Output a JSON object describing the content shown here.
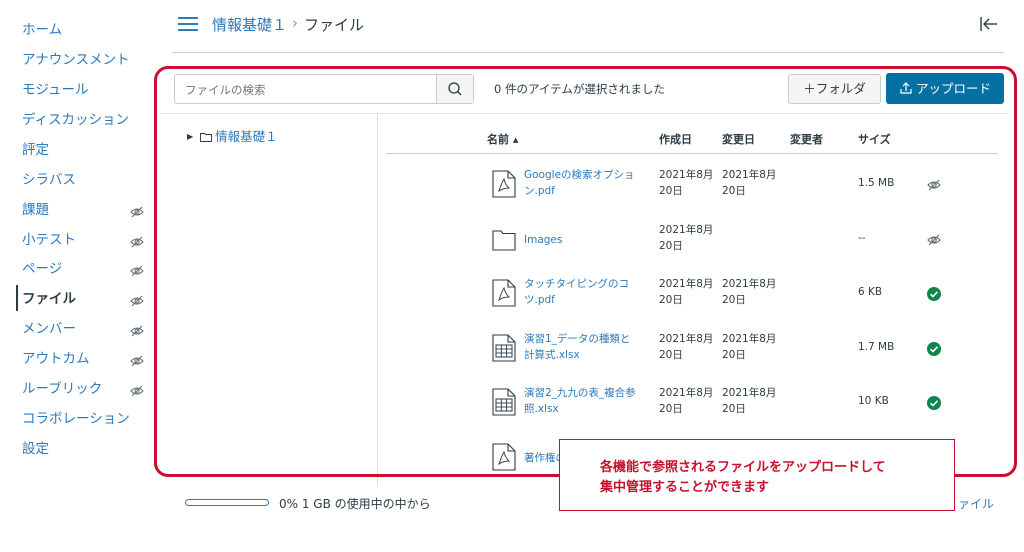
{
  "nav": {
    "items": [
      {
        "label": "ホーム",
        "hidden": false,
        "active": false
      },
      {
        "label": "アナウンスメント",
        "hidden": false,
        "active": false
      },
      {
        "label": "モジュール",
        "hidden": false,
        "active": false
      },
      {
        "label": "ディスカッション",
        "hidden": false,
        "active": false
      },
      {
        "label": "評定",
        "hidden": false,
        "active": false
      },
      {
        "label": "シラバス",
        "hidden": false,
        "active": false
      },
      {
        "label": "課題",
        "hidden": true,
        "active": false
      },
      {
        "label": "小テスト",
        "hidden": true,
        "active": false
      },
      {
        "label": "ページ",
        "hidden": true,
        "active": false
      },
      {
        "label": "ファイル",
        "hidden": true,
        "active": true
      },
      {
        "label": "メンバー",
        "hidden": true,
        "active": false
      },
      {
        "label": "アウトカム",
        "hidden": true,
        "active": false
      },
      {
        "label": "ルーブリック",
        "hidden": true,
        "active": false
      },
      {
        "label": "コラボレーション",
        "hidden": false,
        "active": false
      },
      {
        "label": "設定",
        "hidden": false,
        "active": false
      }
    ]
  },
  "header": {
    "course": "情報基礎１",
    "separator": "›",
    "page": "ファイル"
  },
  "toolbar": {
    "search_placeholder": "ファイルの検索",
    "selection_status": "0 件のアイテムが選択されました",
    "folder_button": "＋フォルダ",
    "upload_button": "アップロード"
  },
  "tree": {
    "root": "情報基礎１"
  },
  "table": {
    "columns": {
      "name": "名前 ▴",
      "created": "作成日",
      "modified": "変更日",
      "modifier": "変更者",
      "size": "サイズ"
    },
    "rows": [
      {
        "icon": "pdf-icon",
        "name": "Googleの検索オプション.pdf",
        "created": "2021年8月20日",
        "modified": "2021年8月20日",
        "size": "1.5 MB",
        "status": "unpublished"
      },
      {
        "icon": "folder-icon",
        "name": "Images",
        "created": "2021年8月20日",
        "modified": "",
        "size": "--",
        "status": "unpublished"
      },
      {
        "icon": "pdf-icon",
        "name": "タッチタイピングのコツ.pdf",
        "created": "2021年8月20日",
        "modified": "2021年8月20日",
        "size": "6 KB",
        "status": "published"
      },
      {
        "icon": "spreadsheet-icon",
        "name": "演習1_データの種類と計算式.xlsx",
        "created": "2021年8月20日",
        "modified": "2021年8月20日",
        "size": "1.7 MB",
        "status": "published"
      },
      {
        "icon": "spreadsheet-icon",
        "name": "演習2_九九の表_複合参照.xlsx",
        "created": "2021年8月20日",
        "modified": "2021年8月20日",
        "size": "10 KB",
        "status": "published"
      },
      {
        "icon": "pdf-icon",
        "name": "著作権の",
        "created": "",
        "modified": "",
        "size": "",
        "status": ""
      }
    ]
  },
  "footer": {
    "usage_percent": 0,
    "usage_text": "0% 1 GB の使用中の中から",
    "link_fragment": "ァイル"
  },
  "callout": {
    "line1": "各機能で参照されるファイルをアップロードして",
    "line2": "集中管理することができます"
  },
  "colors": {
    "link": "#2b7abc",
    "primary_button": "#0770a3",
    "published": "#0b874b",
    "annotation": "#c8102e"
  }
}
